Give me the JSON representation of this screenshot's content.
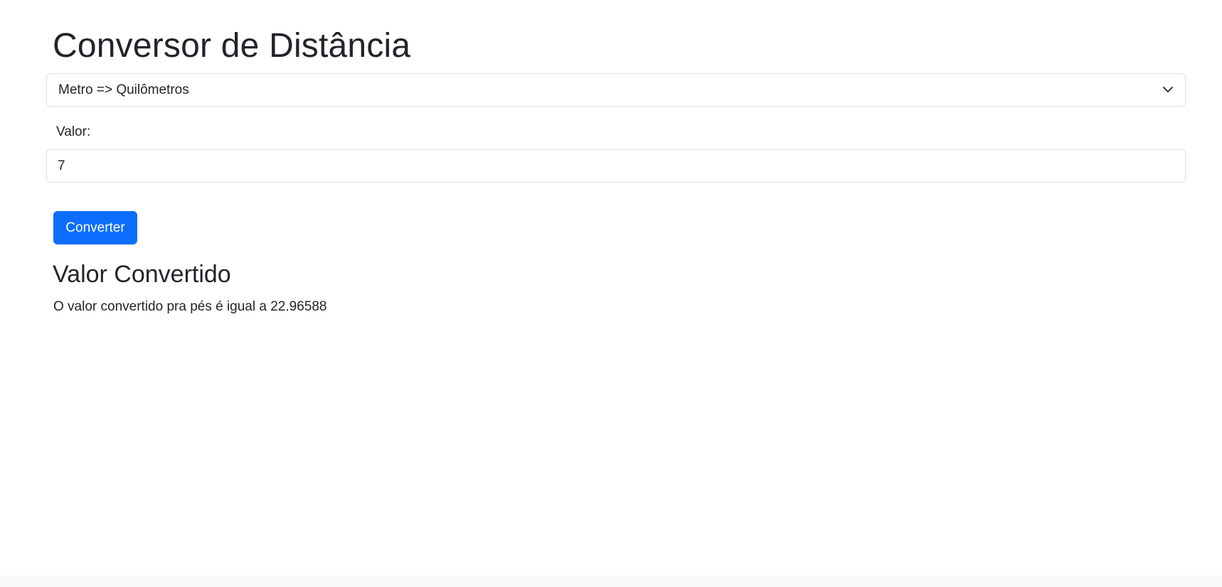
{
  "header": {
    "title": "Conversor de Distância"
  },
  "form": {
    "conversion_select": {
      "selected": "Metro => Quilômetros",
      "icon": "chevron-down-icon"
    },
    "value_label": "Valor:",
    "value_input": "7",
    "submit_label": "Converter"
  },
  "result": {
    "title": "Valor Convertido",
    "text": "O valor convertido pra pés é igual a 22.96588"
  },
  "colors": {
    "primary": "#0d6efd",
    "text": "#212529",
    "border": "#dee2e6",
    "footer_background": "#f8f9fa"
  }
}
